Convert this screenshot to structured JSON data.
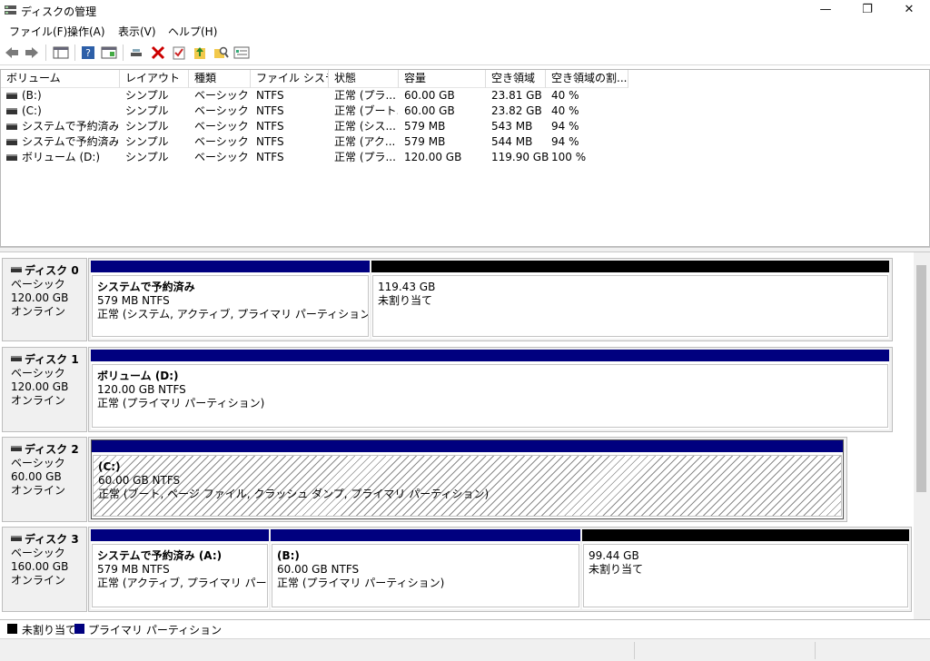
{
  "window": {
    "title": "ディスクの管理",
    "minimize": "—",
    "restore": "❐",
    "close": "✕"
  },
  "menu": [
    "ファイル(F)",
    "操作(A)",
    "表示(V)",
    "ヘルプ(H)"
  ],
  "toolbar_icons": [
    "back-arrow-icon",
    "forward-arrow-icon",
    "console-tree-icon",
    "help-icon",
    "properties-list-icon",
    "connect-icon",
    "delete-icon",
    "check-icon",
    "folder-up-icon",
    "search-folder-icon",
    "settings-panel-icon"
  ],
  "columns": [
    "ボリューム",
    "レイアウト",
    "種類",
    "ファイル システム",
    "状態",
    "容量",
    "空き領域",
    "空き領域の割..."
  ],
  "volumes": [
    {
      "name": "(B:)",
      "layout": "シンプル",
      "type": "ベーシック",
      "fs": "NTFS",
      "status": "正常 (プラ...",
      "capacity": "60.00 GB",
      "free": "23.81 GB",
      "pct": "40 %"
    },
    {
      "name": "(C:)",
      "layout": "シンプル",
      "type": "ベーシック",
      "fs": "NTFS",
      "status": "正常 (ブート...",
      "capacity": "60.00 GB",
      "free": "23.82 GB",
      "pct": "40 %"
    },
    {
      "name": "システムで予約済み",
      "layout": "シンプル",
      "type": "ベーシック",
      "fs": "NTFS",
      "status": "正常 (シス...",
      "capacity": "579 MB",
      "free": "543 MB",
      "pct": "94 %"
    },
    {
      "name": "システムで予約済み ...",
      "layout": "シンプル",
      "type": "ベーシック",
      "fs": "NTFS",
      "status": "正常 (アク...",
      "capacity": "579 MB",
      "free": "544 MB",
      "pct": "94 %"
    },
    {
      "name": "ボリューム (D:)",
      "layout": "シンプル",
      "type": "ベーシック",
      "fs": "NTFS",
      "status": "正常 (プラ...",
      "capacity": "120.00 GB",
      "free": "119.90 GB",
      "pct": "100 %"
    }
  ],
  "disks": [
    {
      "name": "ディスク 0",
      "type": "ベーシック",
      "size": "120.00 GB",
      "state": "オンライン",
      "partitions": [
        {
          "title": "システムで予約済み",
          "line2": "579 MB NTFS",
          "line3": "正常 (システム, アクティブ, プライマリ パーティション)",
          "kind": "primary"
        },
        {
          "title": "",
          "line2": "119.43 GB",
          "line3": "未割り当て",
          "kind": "unallocated"
        }
      ]
    },
    {
      "name": "ディスク 1",
      "type": "ベーシック",
      "size": "120.00 GB",
      "state": "オンライン",
      "partitions": [
        {
          "title": "ボリューム  (D:)",
          "line2": "120.00 GB NTFS",
          "line3": "正常 (プライマリ パーティション)",
          "kind": "primary"
        }
      ]
    },
    {
      "name": "ディスク 2",
      "type": "ベーシック",
      "size": "60.00 GB",
      "state": "オンライン",
      "partitions": [
        {
          "title": "(C:)",
          "line2": "60.00 GB NTFS",
          "line3": "正常 (ブート, ページ ファイル, クラッシュ ダンプ, プライマリ パーティション)",
          "kind": "primary"
        }
      ]
    },
    {
      "name": "ディスク 3",
      "type": "ベーシック",
      "size": "160.00 GB",
      "state": "オンライン",
      "partitions": [
        {
          "title": "システムで予約済み  (A:)",
          "line2": "579 MB NTFS",
          "line3": "正常 (アクティブ, プライマリ パーティション)",
          "kind": "primary"
        },
        {
          "title": "(B:)",
          "line2": "60.00 GB NTFS",
          "line3": "正常 (プライマリ パーティション)",
          "kind": "primary"
        },
        {
          "title": "",
          "line2": "99.44 GB",
          "line3": "未割り当て",
          "kind": "unallocated"
        }
      ]
    }
  ],
  "legend": [
    {
      "label": "未割り当て",
      "color": "#000000"
    },
    {
      "label": "プライマリ パーティション",
      "color": "#00007f"
    }
  ]
}
